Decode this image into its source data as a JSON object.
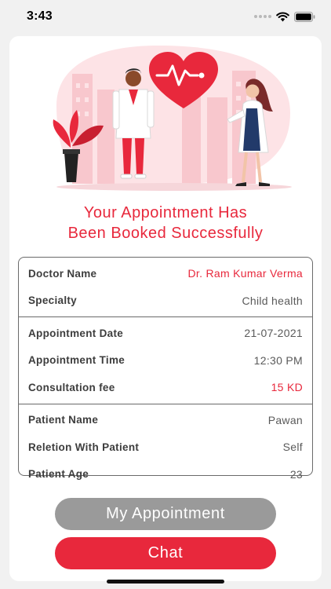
{
  "status_bar": {
    "time": "3:43"
  },
  "illustration": {
    "icons": [
      "heart-pulse-icon",
      "plant-icon",
      "doctor-icon",
      "nurse-icon"
    ]
  },
  "success": {
    "line1": "Your Appointment Has",
    "line2": "Been Booked Successfully"
  },
  "details": {
    "doctor": [
      {
        "label": "Doctor Name",
        "value": "Dr. Ram Kumar Verma",
        "highlight": true
      },
      {
        "label": "Specialty",
        "value": "Child health",
        "highlight": false
      }
    ],
    "appointment": [
      {
        "label": "Appointment Date",
        "value": "21-07-2021",
        "highlight": false
      },
      {
        "label": "Appointment Time",
        "value": "12:30 PM",
        "highlight": false
      },
      {
        "label": "Consultation fee",
        "value": "15 KD",
        "highlight": true
      }
    ],
    "patient": [
      {
        "label": "Patient Name",
        "value": "Pawan",
        "highlight": false
      },
      {
        "label": "Reletion With Patient",
        "value": "Self",
        "highlight": false
      },
      {
        "label": "Patient Age",
        "value": "23",
        "highlight": false
      }
    ]
  },
  "buttons": {
    "my_appointment": "My Appointment",
    "chat": "Chat"
  },
  "colors": {
    "accent": "#e8283c",
    "secondary_button": "#9a9a9a",
    "illustration_pink": "#fde3e6"
  }
}
